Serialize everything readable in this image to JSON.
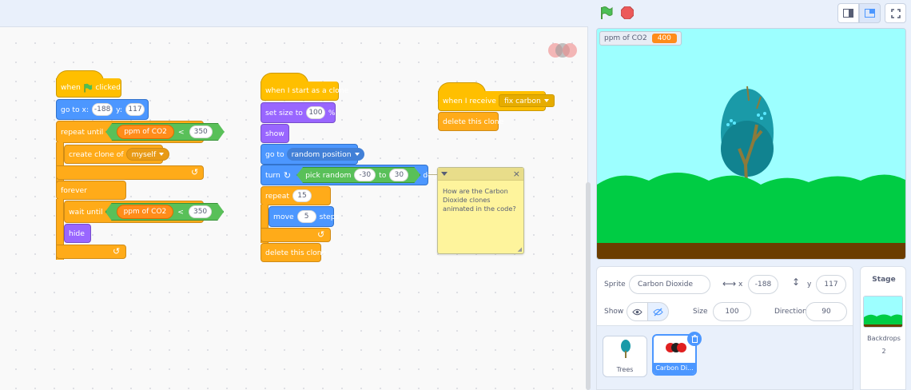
{
  "code": {
    "script1": {
      "hat_when": "when",
      "hat_clicked": "clicked",
      "goto_label": "go to x:",
      "goto_x": "-188",
      "goto_y_label": "y:",
      "goto_y": "117",
      "repeat_until": "repeat until",
      "reporter_ppm": "ppm of CO2",
      "op_lt": "<",
      "value_350": "350",
      "create_clone_label": "create clone of",
      "create_clone_target": "myself",
      "forever": "forever",
      "wait_until": "wait until",
      "hide": "hide"
    },
    "script2": {
      "hat": "when I start as a clone",
      "set_size_label": "set size to",
      "set_size_value": "100",
      "set_size_unit": "%",
      "show": "show",
      "goto_label": "go to",
      "goto_target": "random position",
      "turn_label": "turn",
      "pick_random": "pick random",
      "rand_from": "-30",
      "rand_to_label": "to",
      "rand_to": "30",
      "degrees": "degrees",
      "repeat_label": "repeat",
      "repeat_count": "15",
      "move_label": "move",
      "move_value": "5",
      "move_unit": "steps",
      "delete_clone": "delete this clone"
    },
    "script3": {
      "hat": "when I receive",
      "message": "fix carbon",
      "delete_clone": "delete this clone"
    },
    "comment": "How are the Carbon Dioxide clones animated in the code?"
  },
  "stage": {
    "monitor_label": "ppm of CO2",
    "monitor_value": "400"
  },
  "sprite_info": {
    "sprite_label": "Sprite",
    "sprite_name": "Carbon Dioxide",
    "x_label": "x",
    "x_value": "-188",
    "y_label": "y",
    "y_value": "117",
    "show_label": "Show",
    "size_label": "Size",
    "size_value": "100",
    "direction_label": "Direction",
    "direction_value": "90"
  },
  "sprites": [
    {
      "name": "Trees"
    },
    {
      "name": "Carbon Di..."
    }
  ],
  "stage_panel": {
    "title": "Stage",
    "backdrops_label": "Backdrops",
    "backdrops_count": "2"
  },
  "colors": {
    "events": "#ffbf00",
    "control": "#ffab19",
    "motion": "#4c97ff",
    "looks": "#9966ff",
    "variables": "#ff8c1a",
    "operators": "#59c059",
    "stage_sky": "#9dffff",
    "grass": "#00cc44",
    "ground": "#6b3d00"
  }
}
